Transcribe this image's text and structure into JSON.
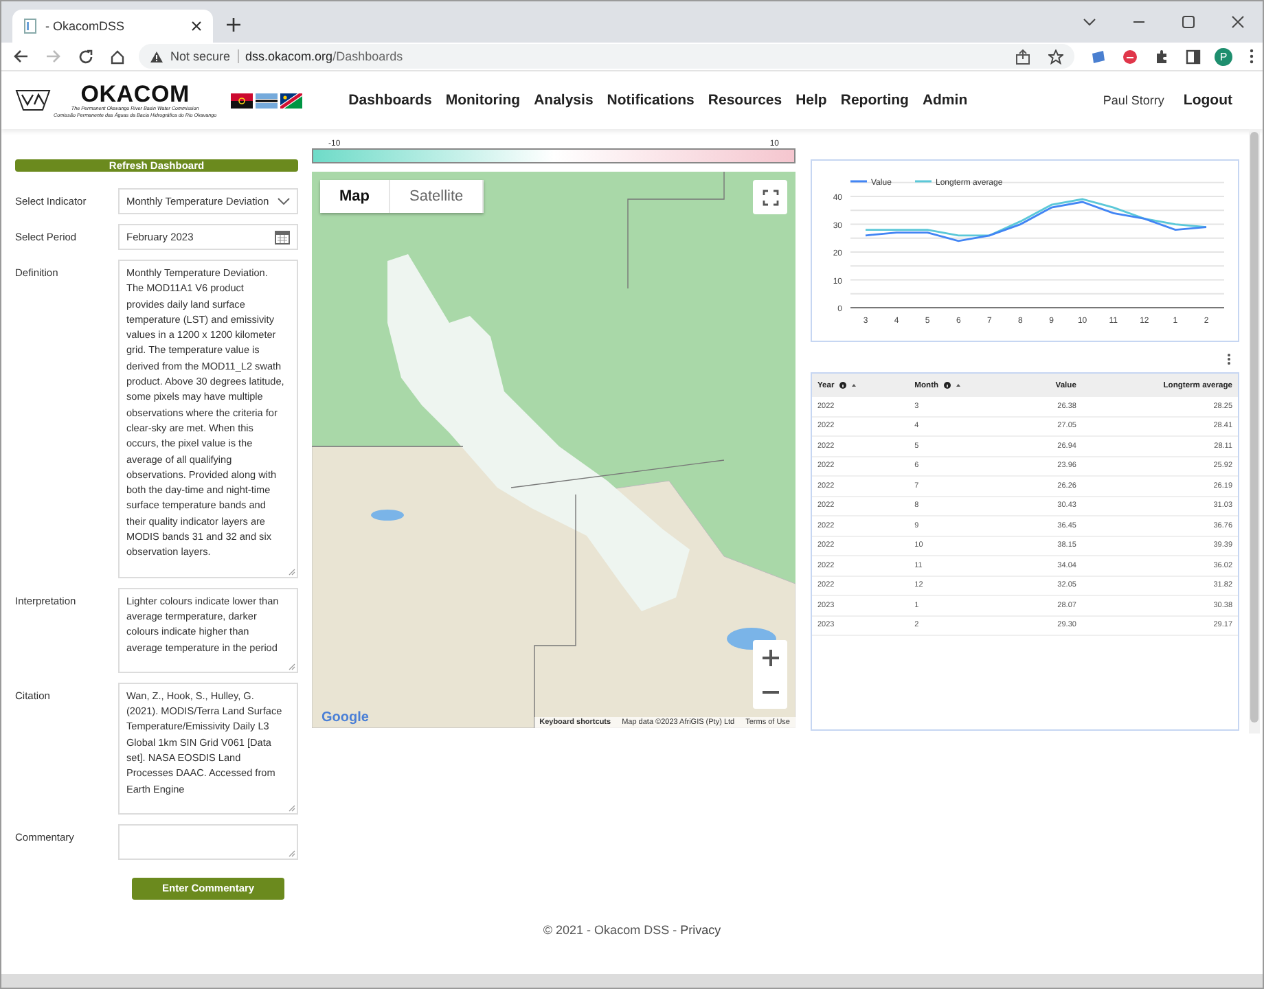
{
  "browser": {
    "tab_title": "- OkacomDSS",
    "security": "Not secure",
    "url_host": "dss.okacom.org",
    "url_path": "/Dashboards",
    "profile_initial": "P"
  },
  "header": {
    "logo_text": "OKACOM",
    "logo_subtitles": [
      "The Permanent Okavango River Basin Water Commission",
      "Comissão Permanente das Águas da Bacia Hidrográfica do Rio Okavango"
    ],
    "nav": [
      {
        "label": "Dashboards"
      },
      {
        "label": "Monitoring"
      },
      {
        "label": "Analysis"
      },
      {
        "label": "Notifications"
      },
      {
        "label": "Resources"
      },
      {
        "label": "Help"
      },
      {
        "label": "Reporting"
      },
      {
        "label": "Admin"
      }
    ],
    "user": "Paul Storry",
    "logout": "Logout"
  },
  "sidebar": {
    "refresh_button": "Refresh Dashboard",
    "fields": [
      {
        "kind": "select",
        "label": "Select Indicator",
        "value": "Monthly Temperature Deviation"
      },
      {
        "kind": "date",
        "label": "Select Period",
        "value": "February 2023"
      },
      {
        "kind": "textarea",
        "label": "Definition",
        "value": "Monthly Temperature Deviation. The MOD11A1 V6 product provides daily land surface temperature (LST) and emissivity values in a 1200 x 1200 kilometer grid. The temperature value is derived from the MOD11_L2 swath product. Above 30 degrees latitude, some pixels may have multiple observations where the criteria for clear-sky are met. When this occurs, the pixel value is the average of all qualifying observations. Provided along with both the day-time and night-time surface temperature bands and their quality indicator layers are MODIS bands 31 and 32 and six observation layers."
      },
      {
        "kind": "textarea",
        "label": "Interpretation",
        "value": "Lighter colours indicate lower than average termperature, darker colours indicate higher than average temperature in the period"
      },
      {
        "kind": "textarea",
        "label": "Citation",
        "value": "Wan, Z., Hook, S., Hulley, G. (2021). MODIS/Terra Land Surface Temperature/Emissivity Daily L3 Global 1km SIN Grid V061 [Data set]. NASA EOSDIS Land Processes DAAC. Accessed from Earth Engine"
      },
      {
        "kind": "textarea",
        "label": "Commentary"
      }
    ],
    "commentary_button": "Enter Commentary"
  },
  "scale": {
    "min": "-10",
    "max": "10"
  },
  "map": {
    "map_types": [
      {
        "label": "Map",
        "selected": true
      },
      {
        "label": "Satellite",
        "selected": false
      }
    ],
    "google": "Google",
    "attribution": [
      "Keyboard shortcuts",
      "Map data ©2023 AfriGIS (Pty) Ltd",
      "Terms of Use"
    ]
  },
  "chart": {
    "chart_data": {
      "type": "line",
      "categories": [
        "3",
        "4",
        "5",
        "6",
        "7",
        "8",
        "9",
        "10",
        "11",
        "12",
        "1",
        "2"
      ],
      "ylim": [
        0,
        40
      ],
      "yticks": [
        0,
        10,
        20,
        30,
        40
      ],
      "grid": true,
      "legend": true,
      "series": [
        {
          "name": "Value",
          "color": "#4285f4",
          "values": [
            26,
            27,
            27,
            24,
            26,
            30,
            36,
            38,
            34,
            32,
            28,
            29
          ]
        },
        {
          "name": "Longterm average",
          "color": "#5bc8d8",
          "values": [
            28,
            28,
            28,
            26,
            26,
            31,
            37,
            39,
            36,
            32,
            30,
            29
          ]
        }
      ]
    }
  },
  "table": {
    "columns": [
      {
        "label": "Year",
        "sortable": true
      },
      {
        "label": "Month",
        "sortable": true
      },
      {
        "label": "Value",
        "sortable": false
      },
      {
        "label": "Longterm average",
        "sortable": false
      }
    ],
    "rows": [
      [
        "2022",
        "3",
        "26.38",
        "28.25"
      ],
      [
        "2022",
        "4",
        "27.05",
        "28.41"
      ],
      [
        "2022",
        "5",
        "26.94",
        "28.11"
      ],
      [
        "2022",
        "6",
        "23.96",
        "25.92"
      ],
      [
        "2022",
        "7",
        "26.26",
        "26.19"
      ],
      [
        "2022",
        "8",
        "30.43",
        "31.03"
      ],
      [
        "2022",
        "9",
        "36.45",
        "36.76"
      ],
      [
        "2022",
        "10",
        "38.15",
        "39.39"
      ],
      [
        "2022",
        "11",
        "34.04",
        "36.02"
      ],
      [
        "2022",
        "12",
        "32.05",
        "31.82"
      ],
      [
        "2023",
        "1",
        "28.07",
        "30.38"
      ],
      [
        "2023",
        "2",
        "29.30",
        "29.17"
      ]
    ]
  },
  "footer": {
    "text": "© 2021 - Okacom DSS - ",
    "link": "Privacy"
  }
}
